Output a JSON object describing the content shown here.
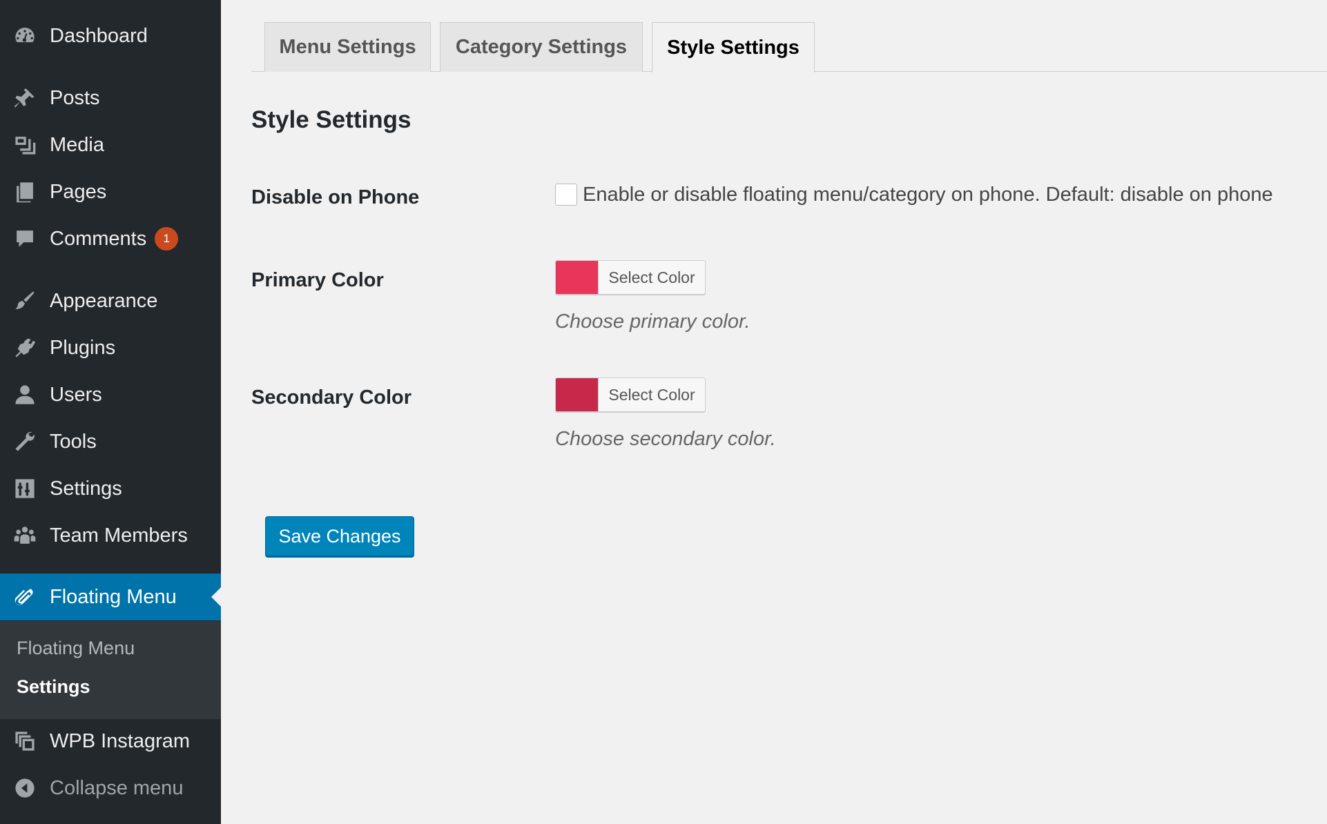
{
  "sidebar": {
    "items": [
      {
        "label": "Dashboard",
        "icon": "dashboard-icon"
      },
      {
        "label": "Posts",
        "icon": "pin-icon"
      },
      {
        "label": "Media",
        "icon": "media-icon"
      },
      {
        "label": "Pages",
        "icon": "pages-icon"
      },
      {
        "label": "Comments",
        "icon": "comment-icon",
        "badge": "1"
      },
      {
        "label": "Appearance",
        "icon": "paintbrush-icon"
      },
      {
        "label": "Plugins",
        "icon": "plugin-icon"
      },
      {
        "label": "Users",
        "icon": "user-icon"
      },
      {
        "label": "Tools",
        "icon": "wrench-icon"
      },
      {
        "label": "Settings",
        "icon": "settings-icon"
      },
      {
        "label": "Team Members",
        "icon": "team-icon"
      },
      {
        "label": "Floating Menu",
        "icon": "paperclip-icon",
        "current": true
      },
      {
        "label": "WPB Instagram",
        "icon": "instagram-gallery-icon"
      },
      {
        "label": "Collapse menu",
        "icon": "collapse-arrow-icon"
      }
    ],
    "submenu": [
      {
        "label": "Floating Menu"
      },
      {
        "label": "Settings",
        "current": true
      }
    ]
  },
  "tabs": [
    {
      "label": "Menu Settings"
    },
    {
      "label": "Category Settings"
    },
    {
      "label": "Style Settings",
      "active": true
    }
  ],
  "page": {
    "heading": "Style Settings",
    "fields": {
      "phone": {
        "label": "Disable on Phone",
        "description": "Enable or disable floating menu/category on phone. Default: disable on phone",
        "checked": false
      },
      "primary": {
        "label": "Primary Color",
        "button": "Select Color",
        "color": "#e8355a",
        "description": "Choose primary color."
      },
      "secondary": {
        "label": "Secondary Color",
        "button": "Select Color",
        "color": "#c7294a",
        "description": "Choose secondary color."
      }
    },
    "save_label": "Save Changes"
  },
  "colors": {
    "sidebar_bg": "#23282d",
    "submenu_bg": "#32373c",
    "accent": "#0073aa",
    "badge": "#ca4a1f",
    "button": "#0085ba"
  }
}
